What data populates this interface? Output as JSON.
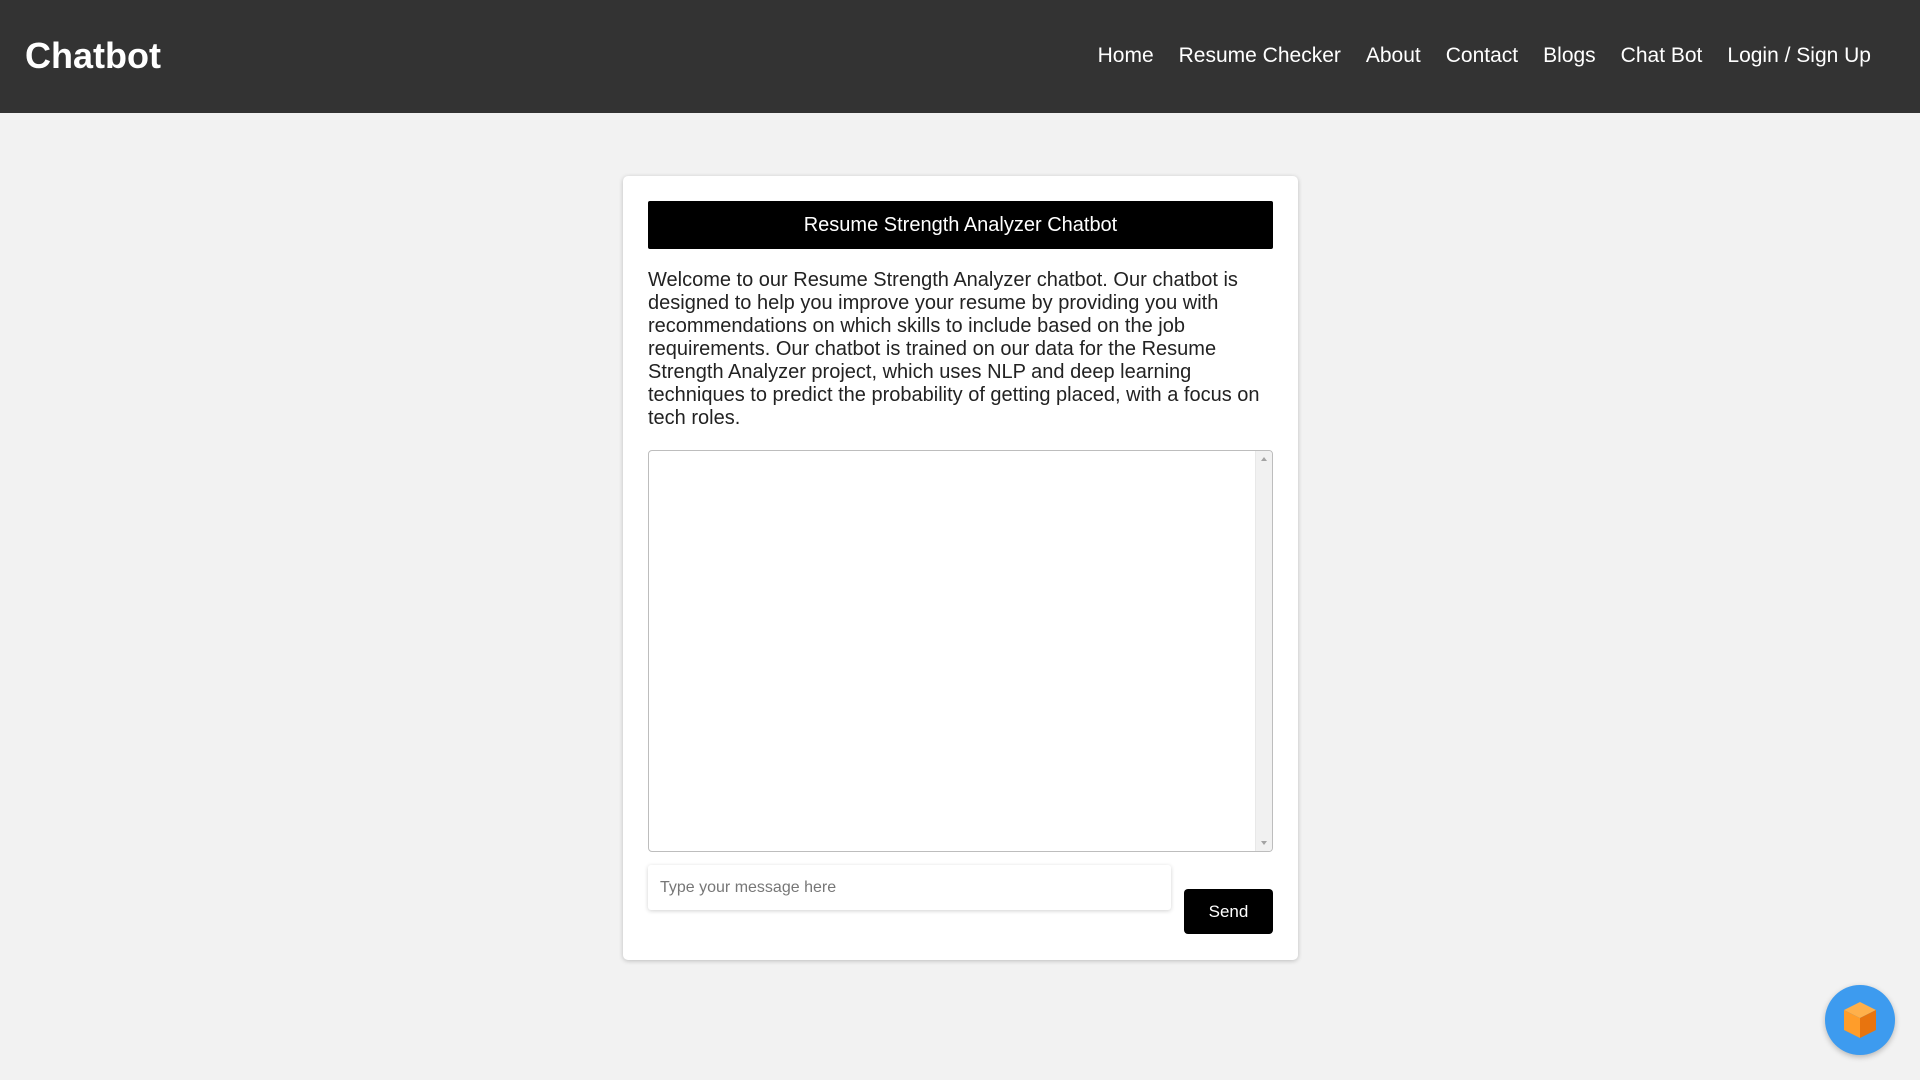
{
  "navbar": {
    "brand": "Chatbot",
    "links": [
      {
        "label": "Home"
      },
      {
        "label": "Resume Checker"
      },
      {
        "label": "About"
      },
      {
        "label": "Contact"
      },
      {
        "label": "Blogs"
      },
      {
        "label": "Chat Bot"
      },
      {
        "label": "Login / Sign Up"
      }
    ]
  },
  "chatbot": {
    "title": "Resume Strength Analyzer Chatbot",
    "intro": "Welcome to our Resume Strength Analyzer chatbot. Our chatbot is designed to help you improve your resume by providing you with recommendations on which skills to include based on the job requirements. Our chatbot is trained on our data for the Resume Strength Analyzer project, which uses NLP and deep learning techniques to predict the probability of getting placed, with a focus on tech roles.",
    "input": {
      "value": "",
      "placeholder": "Type your message here"
    },
    "send_label": "Send"
  },
  "widget": {
    "icon": "cube-icon",
    "colors": {
      "background": "#3d9bef",
      "icon_light": "#ff9d2a",
      "icon_dark": "#e8740e"
    }
  },
  "colors": {
    "navbar": "#333333",
    "page_background": "#f2f2f2",
    "header_background": "#000000",
    "button_background": "#000000"
  }
}
